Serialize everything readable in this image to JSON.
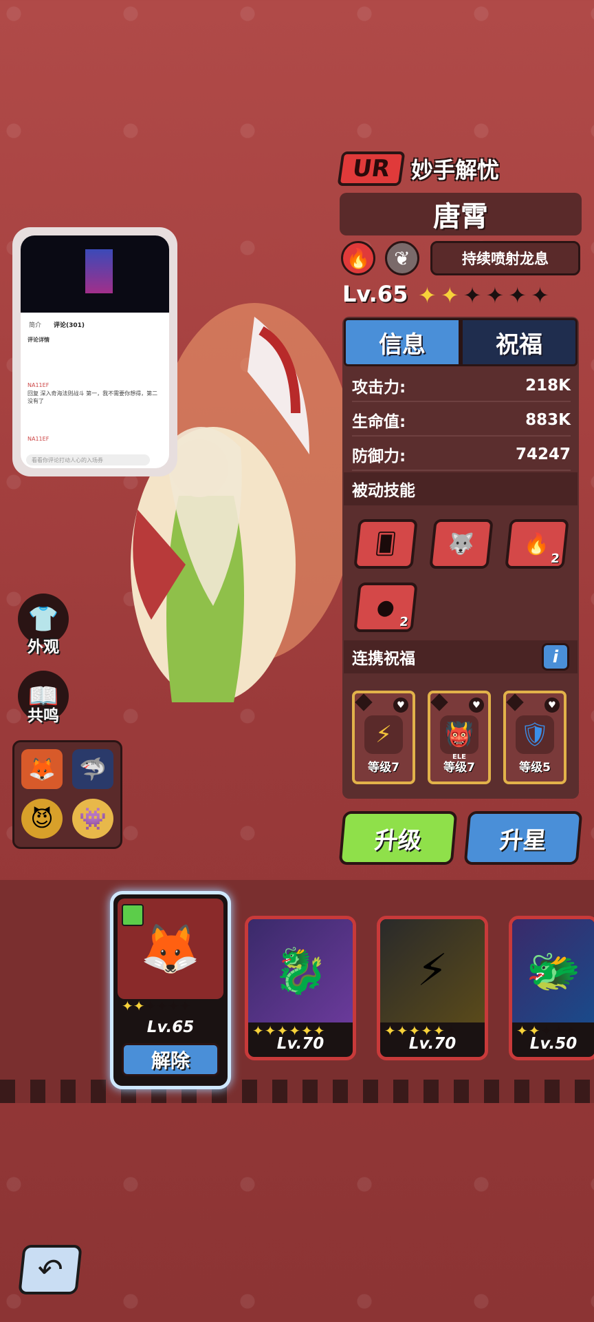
{
  "hero": {
    "rarity": "UR",
    "title": "妙手解忧",
    "name": "唐霄",
    "element_icon": "fire-icon",
    "class_icon": "feather-icon",
    "skill": "持续喷射龙息",
    "level_label": "Lv.65",
    "stars_filled": 2,
    "stars_total": 6
  },
  "tabs": [
    {
      "label": "信息",
      "active": true
    },
    {
      "label": "祝福",
      "active": false
    }
  ],
  "stats": [
    {
      "label": "攻击力:",
      "value": "218K"
    },
    {
      "label": "生命值:",
      "value": "883K"
    },
    {
      "label": "防御力:",
      "value": "74247"
    }
  ],
  "passive": {
    "heading": "被动技能",
    "skills": [
      {
        "icon": "cards-dice-icon",
        "count": ""
      },
      {
        "icon": "beast-head-icon",
        "count": ""
      },
      {
        "icon": "flames-icon",
        "count": "2"
      },
      {
        "icon": "orbs-icon",
        "count": "2"
      }
    ]
  },
  "blessing": {
    "heading": "连携祝福",
    "info_label": "i",
    "items": [
      {
        "icon": "lightning-icon",
        "level": "等级7",
        "color": "#f2c23a"
      },
      {
        "icon": "demon-face-icon",
        "level": "等级7",
        "color": "#e24a4a",
        "extra": "ELE"
      },
      {
        "icon": "shield-icon",
        "level": "等级5",
        "color": "#3a8ee8"
      }
    ]
  },
  "actions": {
    "upgrade": "升级",
    "star_up": "升星"
  },
  "side": {
    "appearance": "外观",
    "resonance": "共鸣"
  },
  "phone": {
    "tab1": "简介",
    "tab2": "评论",
    "tab2_count": "(301)",
    "section": "评论详情",
    "comment": "回复 深入奇海法则战斗 第一，我不需要你想得，第二没有了",
    "user": "NA11EF",
    "input_placeholder": "看看你评论打动人心的入场券"
  },
  "roster": [
    {
      "level": "Lv.65",
      "stars_filled": 2,
      "stars_total": 6,
      "selected": true,
      "action": "解除"
    },
    {
      "level": "Lv.70",
      "stars_filled": 6,
      "stars_total": 6,
      "selected": false
    },
    {
      "level": "Lv.70",
      "stars_filled": 5,
      "stars_total": 6,
      "selected": false
    },
    {
      "level": "Lv.50",
      "stars_filled": 2,
      "stars_total": 6,
      "selected": false
    }
  ],
  "colors": {
    "accent_blue": "#4a8fd8",
    "accent_green": "#8fe04a",
    "rarity_red": "#e03a3a",
    "star_gold": "#f7d23a"
  }
}
